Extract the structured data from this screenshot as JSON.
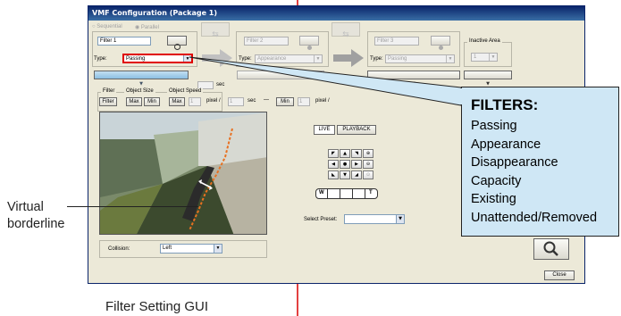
{
  "window": {
    "title": "VMF Configuration (Package 1)",
    "mode_sequential": "Sequential",
    "mode_parallel": "Parallel",
    "filter1": {
      "name": "Filter 1",
      "type_label": "Type:",
      "type_value": "Passing"
    },
    "filter2": {
      "name": "Filter 2",
      "type_label": "Type:",
      "type_value": "Appearance"
    },
    "filter3": {
      "name": "Filter 3",
      "type_label": "Type:",
      "type_value": "Passing"
    },
    "inactive_area": {
      "label": "Inactive Area",
      "value": "1"
    },
    "sec_label": "sec",
    "tabs": {
      "filter": "Filter",
      "object_size": "Object Size",
      "object_speed": "Object Speed"
    },
    "buttons": {
      "filter": "Filter",
      "max": "Max",
      "min": "Min",
      "max2": "Max",
      "min2": "Min",
      "close": "Close"
    },
    "speed": {
      "max_value": "1",
      "pixel1": "pixel /",
      "sec_value": "1",
      "sec": "sec",
      "dash": "—",
      "min_value": "1",
      "pixel2": "pixel /"
    },
    "live": "LIVE",
    "playback": "PLAYBACK",
    "zoom_w": "W",
    "zoom_t": "T",
    "select_preset": "Select Preset:",
    "collision_label": "Collision:",
    "collision_value": "Left"
  },
  "callout": {
    "heading": "FILTERS:",
    "items": [
      "Passing",
      "Appearance",
      "Disappearance",
      "Capacity",
      "Existing",
      "Unattended/Removed"
    ]
  },
  "annotations": {
    "virtual_line1": "Virtual",
    "virtual_line2": "borderline",
    "caption": "Filter Setting GUI"
  },
  "colors": {
    "title_bar": "#0a246a",
    "highlight": "#e00000",
    "callout_bg": "#cfe7f5",
    "marker": "#e34040"
  }
}
